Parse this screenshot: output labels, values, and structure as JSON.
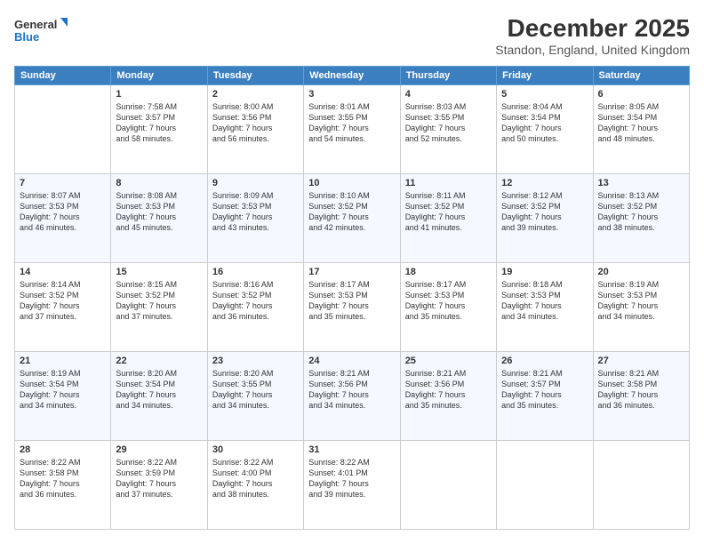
{
  "header": {
    "logo_line1": "General",
    "logo_line2": "Blue",
    "title": "December 2025",
    "subtitle": "Standon, England, United Kingdom"
  },
  "days_of_week": [
    "Sunday",
    "Monday",
    "Tuesday",
    "Wednesday",
    "Thursday",
    "Friday",
    "Saturday"
  ],
  "weeks": [
    [
      {
        "day": "",
        "info": ""
      },
      {
        "day": "1",
        "info": "Sunrise: 7:58 AM\nSunset: 3:57 PM\nDaylight: 7 hours\nand 58 minutes."
      },
      {
        "day": "2",
        "info": "Sunrise: 8:00 AM\nSunset: 3:56 PM\nDaylight: 7 hours\nand 56 minutes."
      },
      {
        "day": "3",
        "info": "Sunrise: 8:01 AM\nSunset: 3:55 PM\nDaylight: 7 hours\nand 54 minutes."
      },
      {
        "day": "4",
        "info": "Sunrise: 8:03 AM\nSunset: 3:55 PM\nDaylight: 7 hours\nand 52 minutes."
      },
      {
        "day": "5",
        "info": "Sunrise: 8:04 AM\nSunset: 3:54 PM\nDaylight: 7 hours\nand 50 minutes."
      },
      {
        "day": "6",
        "info": "Sunrise: 8:05 AM\nSunset: 3:54 PM\nDaylight: 7 hours\nand 48 minutes."
      }
    ],
    [
      {
        "day": "7",
        "info": "Sunrise: 8:07 AM\nSunset: 3:53 PM\nDaylight: 7 hours\nand 46 minutes."
      },
      {
        "day": "8",
        "info": "Sunrise: 8:08 AM\nSunset: 3:53 PM\nDaylight: 7 hours\nand 45 minutes."
      },
      {
        "day": "9",
        "info": "Sunrise: 8:09 AM\nSunset: 3:53 PM\nDaylight: 7 hours\nand 43 minutes."
      },
      {
        "day": "10",
        "info": "Sunrise: 8:10 AM\nSunset: 3:52 PM\nDaylight: 7 hours\nand 42 minutes."
      },
      {
        "day": "11",
        "info": "Sunrise: 8:11 AM\nSunset: 3:52 PM\nDaylight: 7 hours\nand 41 minutes."
      },
      {
        "day": "12",
        "info": "Sunrise: 8:12 AM\nSunset: 3:52 PM\nDaylight: 7 hours\nand 39 minutes."
      },
      {
        "day": "13",
        "info": "Sunrise: 8:13 AM\nSunset: 3:52 PM\nDaylight: 7 hours\nand 38 minutes."
      }
    ],
    [
      {
        "day": "14",
        "info": "Sunrise: 8:14 AM\nSunset: 3:52 PM\nDaylight: 7 hours\nand 37 minutes."
      },
      {
        "day": "15",
        "info": "Sunrise: 8:15 AM\nSunset: 3:52 PM\nDaylight: 7 hours\nand 37 minutes."
      },
      {
        "day": "16",
        "info": "Sunrise: 8:16 AM\nSunset: 3:52 PM\nDaylight: 7 hours\nand 36 minutes."
      },
      {
        "day": "17",
        "info": "Sunrise: 8:17 AM\nSunset: 3:53 PM\nDaylight: 7 hours\nand 35 minutes."
      },
      {
        "day": "18",
        "info": "Sunrise: 8:17 AM\nSunset: 3:53 PM\nDaylight: 7 hours\nand 35 minutes."
      },
      {
        "day": "19",
        "info": "Sunrise: 8:18 AM\nSunset: 3:53 PM\nDaylight: 7 hours\nand 34 minutes."
      },
      {
        "day": "20",
        "info": "Sunrise: 8:19 AM\nSunset: 3:53 PM\nDaylight: 7 hours\nand 34 minutes."
      }
    ],
    [
      {
        "day": "21",
        "info": "Sunrise: 8:19 AM\nSunset: 3:54 PM\nDaylight: 7 hours\nand 34 minutes."
      },
      {
        "day": "22",
        "info": "Sunrise: 8:20 AM\nSunset: 3:54 PM\nDaylight: 7 hours\nand 34 minutes."
      },
      {
        "day": "23",
        "info": "Sunrise: 8:20 AM\nSunset: 3:55 PM\nDaylight: 7 hours\nand 34 minutes."
      },
      {
        "day": "24",
        "info": "Sunrise: 8:21 AM\nSunset: 3:56 PM\nDaylight: 7 hours\nand 34 minutes."
      },
      {
        "day": "25",
        "info": "Sunrise: 8:21 AM\nSunset: 3:56 PM\nDaylight: 7 hours\nand 35 minutes."
      },
      {
        "day": "26",
        "info": "Sunrise: 8:21 AM\nSunset: 3:57 PM\nDaylight: 7 hours\nand 35 minutes."
      },
      {
        "day": "27",
        "info": "Sunrise: 8:21 AM\nSunset: 3:58 PM\nDaylight: 7 hours\nand 36 minutes."
      }
    ],
    [
      {
        "day": "28",
        "info": "Sunrise: 8:22 AM\nSunset: 3:58 PM\nDaylight: 7 hours\nand 36 minutes."
      },
      {
        "day": "29",
        "info": "Sunrise: 8:22 AM\nSunset: 3:59 PM\nDaylight: 7 hours\nand 37 minutes."
      },
      {
        "day": "30",
        "info": "Sunrise: 8:22 AM\nSunset: 4:00 PM\nDaylight: 7 hours\nand 38 minutes."
      },
      {
        "day": "31",
        "info": "Sunrise: 8:22 AM\nSunset: 4:01 PM\nDaylight: 7 hours\nand 39 minutes."
      },
      {
        "day": "",
        "info": ""
      },
      {
        "day": "",
        "info": ""
      },
      {
        "day": "",
        "info": ""
      }
    ]
  ]
}
